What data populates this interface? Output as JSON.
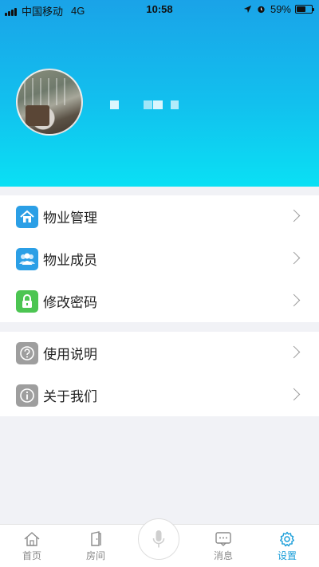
{
  "status_bar": {
    "carrier": "中国移动",
    "network": "4G",
    "time": "10:58",
    "battery": "59%",
    "battery_level": 0.59
  },
  "profile": {
    "avatar_icon": "user-avatar-photo"
  },
  "menu": {
    "group1": [
      {
        "label": "物业管理",
        "icon": "home-icon",
        "color": "#2b9fe6"
      },
      {
        "label": "物业成员",
        "icon": "members-icon",
        "color": "#2b9fe6"
      },
      {
        "label": "修改密码",
        "icon": "lock-icon",
        "color": "#4cc552"
      }
    ],
    "group2": [
      {
        "label": "使用说明",
        "icon": "help-icon",
        "color": "#9e9e9e"
      },
      {
        "label": "关于我们",
        "icon": "info-icon",
        "color": "#9e9e9e"
      }
    ]
  },
  "tabbar": {
    "home": "首页",
    "rooms": "房间",
    "messages": "消息",
    "settings": "设置",
    "active": "settings",
    "active_color": "#1a9ed9"
  }
}
